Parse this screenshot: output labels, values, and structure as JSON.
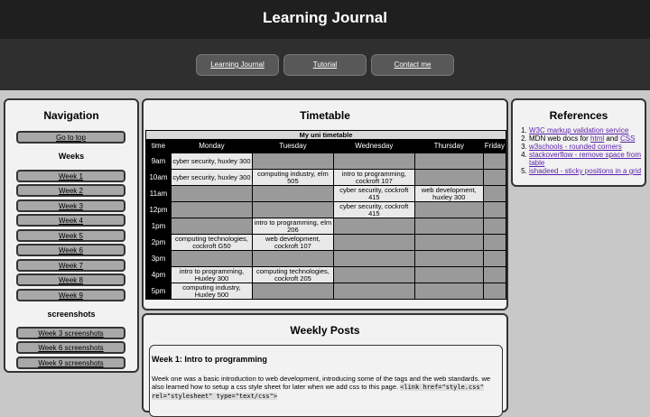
{
  "header": {
    "title": "Learning Journal"
  },
  "topnav": [
    {
      "label": "Learning Journal"
    },
    {
      "label": "Tutorial"
    },
    {
      "label": "Contact me"
    }
  ],
  "sidebar": {
    "title": "Navigation",
    "top_button": "Go to top",
    "weeks_heading": "Weeks",
    "weeks": [
      "Week 1",
      "Week 2",
      "Week 3",
      "Week 4",
      "Week 5",
      "Week 6",
      "Week 7",
      "Week 8",
      "Week 9"
    ],
    "screenshots_heading": "screenshots",
    "screenshots": [
      "Week 3 screenshots",
      "Week 6 screenshots",
      "Week 9 screenshots"
    ]
  },
  "timetable": {
    "title": "Timetable",
    "caption": "My uni timetable",
    "headers": [
      "time",
      "Monday",
      "Tuesday",
      "Wednesday",
      "Thursday",
      "Friday"
    ],
    "rows": [
      {
        "time": "9am",
        "cells": [
          [
            "w",
            "cyber security, huxley 300"
          ],
          [
            "g",
            ""
          ],
          [
            "g",
            ""
          ],
          [
            "g",
            ""
          ],
          [
            "g",
            ""
          ]
        ]
      },
      {
        "time": "10am",
        "cells": [
          [
            "w",
            "cyber security, huxley 300"
          ],
          [
            "w",
            "computing industry, elm 505"
          ],
          [
            "w",
            "intro to programming, cockroft 107"
          ],
          [
            "g",
            ""
          ],
          [
            "g",
            ""
          ]
        ]
      },
      {
        "time": "11am",
        "cells": [
          [
            "g",
            ""
          ],
          [
            "g",
            ""
          ],
          [
            "w",
            "cyber security, cockroft 415"
          ],
          [
            "w",
            "web development, huxley 300"
          ],
          [
            "g",
            ""
          ]
        ]
      },
      {
        "time": "12pm",
        "cells": [
          [
            "g",
            ""
          ],
          [
            "g",
            ""
          ],
          [
            "w",
            "cyber security, cockroft 415"
          ],
          [
            "g",
            ""
          ],
          [
            "g",
            ""
          ]
        ]
      },
      {
        "time": "1pm",
        "cells": [
          [
            "g",
            ""
          ],
          [
            "w",
            "intro to programming, elm 206"
          ],
          [
            "g",
            ""
          ],
          [
            "g",
            ""
          ],
          [
            "g",
            ""
          ]
        ]
      },
      {
        "time": "2pm",
        "cells": [
          [
            "w",
            "computing technologies, cockroft G50"
          ],
          [
            "w",
            "web development, cockroft 107"
          ],
          [
            "g",
            ""
          ],
          [
            "g",
            ""
          ],
          [
            "g",
            ""
          ]
        ]
      },
      {
        "time": "3pm",
        "cells": [
          [
            "g",
            ""
          ],
          [
            "g",
            ""
          ],
          [
            "g",
            ""
          ],
          [
            "g",
            ""
          ],
          [
            "g",
            ""
          ]
        ]
      },
      {
        "time": "4pm",
        "cells": [
          [
            "w",
            "intro to programming, Huxley 300"
          ],
          [
            "w",
            "computing technologies, cockroft 205"
          ],
          [
            "g",
            ""
          ],
          [
            "g",
            ""
          ],
          [
            "g",
            ""
          ]
        ]
      },
      {
        "time": "5pm",
        "cells": [
          [
            "w",
            "computing industry, Huxley 500"
          ],
          [
            "g",
            ""
          ],
          [
            "g",
            ""
          ],
          [
            "g",
            ""
          ],
          [
            "g",
            ""
          ]
        ]
      }
    ]
  },
  "references": {
    "title": "References",
    "items": [
      {
        "pre": "",
        "link": "W3C markup validation service",
        "mid": "",
        "link2": "",
        "post": ""
      },
      {
        "pre": "MDN web docs for ",
        "link": "html",
        "mid": " and ",
        "link2": "CSS",
        "post": ""
      },
      {
        "pre": "",
        "link": "w3schools - rounded corners",
        "mid": "",
        "link2": "",
        "post": ""
      },
      {
        "pre": "",
        "link": "stackoverflow - remove space from table",
        "mid": "",
        "link2": "",
        "post": ""
      },
      {
        "pre": "",
        "link": "ishadeed - sticky positions in a grid",
        "mid": "",
        "link2": "",
        "post": ""
      }
    ]
  },
  "posts": {
    "title": "Weekly Posts",
    "week1_title": "Week 1: Intro to programming",
    "week1_text": "Week one was a basic introduction to web development, introducing some of the tags and the web standards. we also learned how to setup a css style sheet for later when we add css to this page. ",
    "week1_code": "<link href=\"style.css\" rel=\"stylesheet\" type=\"text/css\">"
  }
}
